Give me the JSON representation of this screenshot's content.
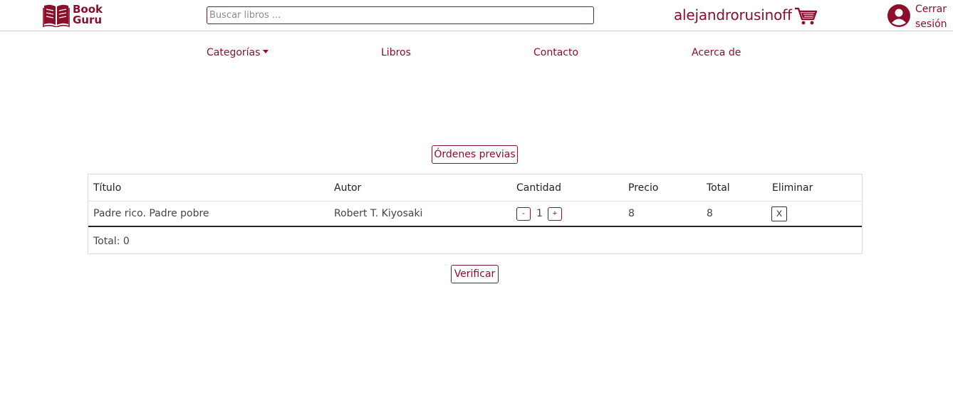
{
  "brand": {
    "line1": "Book",
    "line2": "Guru",
    "color": "#8b0f2b"
  },
  "search": {
    "placeholder": "Buscar libros ...",
    "value": ""
  },
  "header": {
    "username": "alejandrorusinoff",
    "logout_line1": "Cerrar",
    "logout_line2": "sesión"
  },
  "nav": {
    "categories": "Categorías",
    "books": "Libros",
    "contact": "Contacto",
    "about": "Acerca de"
  },
  "buttons": {
    "previous_orders": "Órdenes previas",
    "checkout": "Verificar"
  },
  "table": {
    "headers": {
      "title": "Título",
      "author": "Autor",
      "quantity": "Cantidad",
      "price": "Precio",
      "total": "Total",
      "remove": "Eliminar"
    },
    "rows": [
      {
        "title": "Padre rico. Padre pobre",
        "author": "Robert T. Kiyosaki",
        "quantity": "1",
        "price": "8",
        "total": "8",
        "decrement": "-",
        "increment": "+",
        "remove": "X"
      }
    ],
    "total_label": "Total: 0"
  },
  "icons": {
    "logo": "open-book-icon",
    "cart": "shopping-cart-icon",
    "user": "user-circle-icon",
    "categories_caret": "caret-down-icon"
  }
}
